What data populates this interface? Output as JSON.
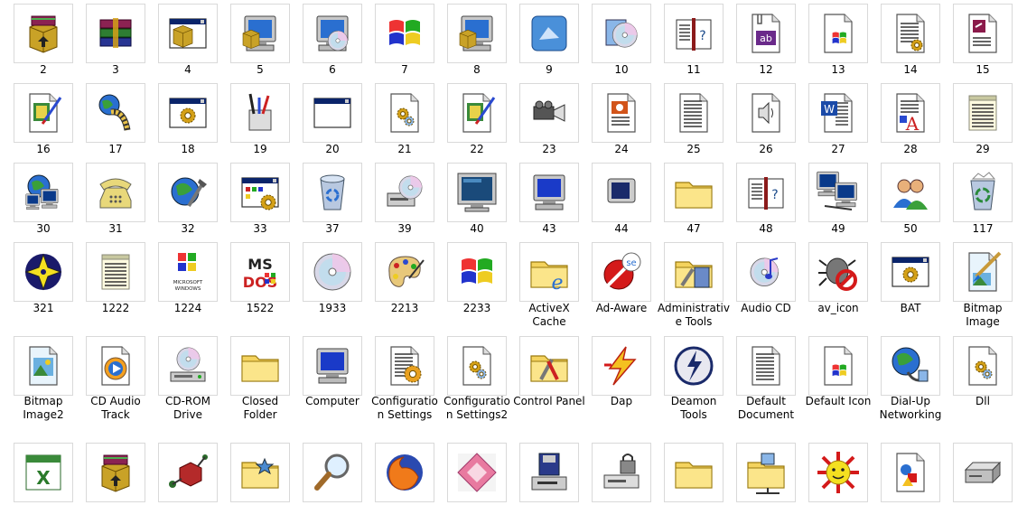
{
  "rows": [
    [
      {
        "label": "2",
        "icon": "winrar-installer-icon"
      },
      {
        "label": "3",
        "icon": "winrar-books-icon"
      },
      {
        "label": "4",
        "icon": "setup-box-window-icon"
      },
      {
        "label": "5",
        "icon": "computer-setup-icon"
      },
      {
        "label": "6",
        "icon": "cd-installer-icon"
      },
      {
        "label": "7",
        "icon": "windows-logo-icon"
      },
      {
        "label": "8",
        "icon": "computer-setup-icon"
      },
      {
        "label": "9",
        "icon": "blue-tile-icon"
      },
      {
        "label": "10",
        "icon": "cd-package-icon"
      },
      {
        "label": "11",
        "icon": "help-book-icon"
      },
      {
        "label": "12",
        "icon": "text-ab-file-icon"
      },
      {
        "label": "13",
        "icon": "windows-document-icon"
      },
      {
        "label": "14",
        "icon": "settings-document-icon"
      },
      {
        "label": "15",
        "icon": "access-document-icon"
      }
    ],
    [
      {
        "label": "16",
        "icon": "paint-document-icon"
      },
      {
        "label": "17",
        "icon": "globe-film-icon"
      },
      {
        "label": "18",
        "icon": "gear-window-icon"
      },
      {
        "label": "19",
        "icon": "tools-cup-icon"
      },
      {
        "label": "20",
        "icon": "blank-window-icon"
      },
      {
        "label": "21",
        "icon": "gear-document-icon"
      },
      {
        "label": "22",
        "icon": "paint-document-icon"
      },
      {
        "label": "23",
        "icon": "video-camera-icon"
      },
      {
        "label": "24",
        "icon": "powerpoint-document-icon"
      },
      {
        "label": "25",
        "icon": "text-document-icon"
      },
      {
        "label": "26",
        "icon": "sound-document-icon"
      },
      {
        "label": "27",
        "icon": "word-document-icon"
      },
      {
        "label": "28",
        "icon": "font-document-icon"
      },
      {
        "label": "29",
        "icon": "notepad-icon"
      }
    ],
    [
      {
        "label": "30",
        "icon": "network-globe-icon"
      },
      {
        "label": "31",
        "icon": "telephone-icon"
      },
      {
        "label": "32",
        "icon": "globe-tools-icon"
      },
      {
        "label": "33",
        "icon": "control-window-gear-icon"
      },
      {
        "label": "37",
        "icon": "recycle-bin-empty-icon"
      },
      {
        "label": "39",
        "icon": "cd-drive-icon"
      },
      {
        "label": "40",
        "icon": "monitor-icon"
      },
      {
        "label": "43",
        "icon": "computer-icon"
      },
      {
        "label": "44",
        "icon": "moon-monitor-icon"
      },
      {
        "label": "47",
        "icon": "folder-icon"
      },
      {
        "label": "48",
        "icon": "help-book-icon"
      },
      {
        "label": "49",
        "icon": "network-computers-icon"
      },
      {
        "label": "50",
        "icon": "users-icon"
      },
      {
        "label": "117",
        "icon": "recycle-bin-full-icon"
      }
    ],
    [
      {
        "label": "321",
        "icon": "star-emblem-icon"
      },
      {
        "label": "1222",
        "icon": "notepad-icon"
      },
      {
        "label": "1224",
        "icon": "microsoft-windows-logo-icon"
      },
      {
        "label": "1522",
        "icon": "ms-dos-icon"
      },
      {
        "label": "1933",
        "icon": "cd-disc-icon"
      },
      {
        "label": "2213",
        "icon": "paint-palette-icon"
      },
      {
        "label": "2233",
        "icon": "windows-logo-icon"
      },
      {
        "label": "ActiveX Cache",
        "icon": "ie-folder-icon"
      },
      {
        "label": "Ad-Aware",
        "icon": "ad-aware-icon"
      },
      {
        "label": "Administrative Tools",
        "icon": "admin-tools-icon"
      },
      {
        "label": "Audio CD",
        "icon": "audio-cd-icon"
      },
      {
        "label": "av_icon",
        "icon": "av-bug-icon"
      },
      {
        "label": "BAT",
        "icon": "gear-window-icon"
      },
      {
        "label": "Bitmap Image",
        "icon": "bitmap-brush-icon"
      }
    ],
    [
      {
        "label": "Bitmap Image2",
        "icon": "bitmap-image-icon"
      },
      {
        "label": "CD Audio Track",
        "icon": "cd-audio-track-icon"
      },
      {
        "label": "CD-ROM Drive",
        "icon": "cd-rom-drive-icon"
      },
      {
        "label": "Closed Folder",
        "icon": "folder-icon"
      },
      {
        "label": "Computer",
        "icon": "computer-icon"
      },
      {
        "label": "Configuration Settings",
        "icon": "config-settings-icon"
      },
      {
        "label": "Configuration Settings2",
        "icon": "gear-document-icon"
      },
      {
        "label": "Control Panel",
        "icon": "control-panel-icon"
      },
      {
        "label": "Dap",
        "icon": "lightning-icon"
      },
      {
        "label": "Deamon Tools",
        "icon": "daemon-tools-icon"
      },
      {
        "label": "Default Document",
        "icon": "text-document-icon"
      },
      {
        "label": "Default Icon",
        "icon": "windows-document-icon"
      },
      {
        "label": "Dial-Up Networking",
        "icon": "dialup-globe-icon"
      },
      {
        "label": "Dll",
        "icon": "gear-document-icon"
      }
    ],
    [
      {
        "label": "",
        "icon": "excel-icon"
      },
      {
        "label": "",
        "icon": "winrar-installer-icon"
      },
      {
        "label": "",
        "icon": "molecule-box-icon"
      },
      {
        "label": "",
        "icon": "star-folder-icon"
      },
      {
        "label": "",
        "icon": "magnifier-icon"
      },
      {
        "label": "",
        "icon": "firefox-icon"
      },
      {
        "label": "",
        "icon": "pink-diamond-icon"
      },
      {
        "label": "",
        "icon": "floppy-drive-icon"
      },
      {
        "label": "",
        "icon": "lock-drive-icon"
      },
      {
        "label": "",
        "icon": "folder-icon"
      },
      {
        "label": "",
        "icon": "network-folder-icon"
      },
      {
        "label": "",
        "icon": "sun-face-icon"
      },
      {
        "label": "",
        "icon": "shapes-document-icon"
      },
      {
        "label": "",
        "icon": "hard-drive-icon"
      }
    ]
  ]
}
